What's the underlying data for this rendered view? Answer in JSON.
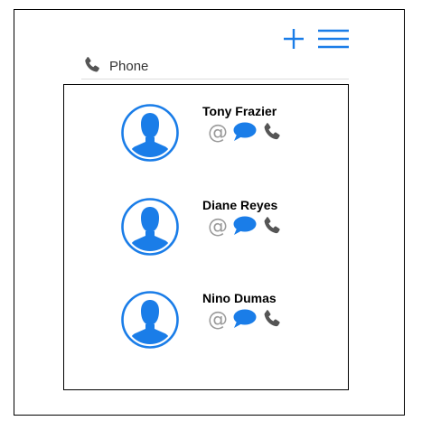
{
  "header": {
    "add_icon": "plus-icon",
    "menu_icon": "hamburger-menu-icon"
  },
  "section": {
    "icon": "phone-icon",
    "label": "Phone"
  },
  "contacts": [
    {
      "name": "Tony Frazier"
    },
    {
      "name": "Diane Reyes"
    },
    {
      "name": "Nino Dumas"
    }
  ],
  "actions": {
    "email_icon": "at-sign-icon",
    "chat_icon": "speech-bubble-icon",
    "call_icon": "phone-icon"
  },
  "colors": {
    "accent": "#1a7de8",
    "icon_gray": "#555555",
    "email_gray": "#9a9a9a"
  }
}
